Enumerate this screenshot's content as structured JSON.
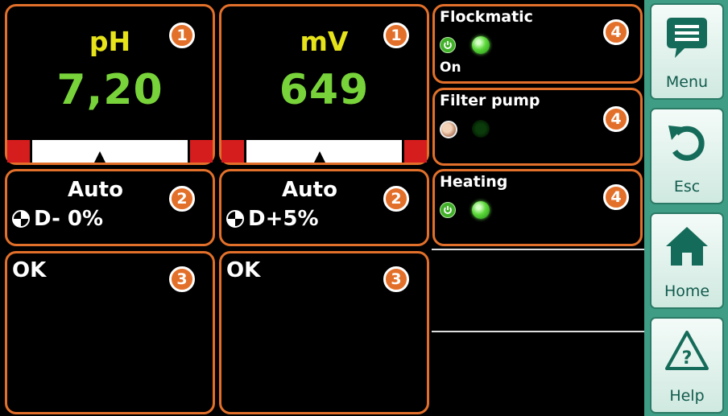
{
  "colors": {
    "accent": "#e2702a",
    "measure_label": "#e6e31a",
    "measure_value": "#78d33a",
    "sidebar": "#3f9d85"
  },
  "measurements": [
    {
      "label": "pH",
      "value": "7,20",
      "callout": "1",
      "scale_pointer_pct": 45
    },
    {
      "label": "mV",
      "value": "649",
      "callout": "1",
      "scale_pointer_pct": 48
    }
  ],
  "control": [
    {
      "mode": "Auto",
      "dose": "D- 0%",
      "callout": "2"
    },
    {
      "mode": "Auto",
      "dose": "D+5%",
      "callout": "2"
    }
  ],
  "status": [
    {
      "text": "OK",
      "callout": "3"
    },
    {
      "text": "OK",
      "callout": "3"
    }
  ],
  "devices": [
    {
      "name": "Flockmatic",
      "state": "On",
      "callout": "4",
      "mode_icon": "power-icon",
      "led": "on"
    },
    {
      "name": "Filter pump",
      "state": "",
      "callout": "4",
      "mode_icon": "hand-icon",
      "led": "off"
    },
    {
      "name": "Heating",
      "state": "",
      "callout": "4",
      "mode_icon": "power-icon",
      "led": "on"
    }
  ],
  "sidebar": {
    "menu": {
      "label": "Menu",
      "icon": "menu-icon"
    },
    "esc": {
      "label": "Esc",
      "icon": "back-arrow-icon"
    },
    "home": {
      "label": "Home",
      "icon": "home-icon"
    },
    "help": {
      "label": "Help",
      "icon": "help-icon"
    }
  }
}
